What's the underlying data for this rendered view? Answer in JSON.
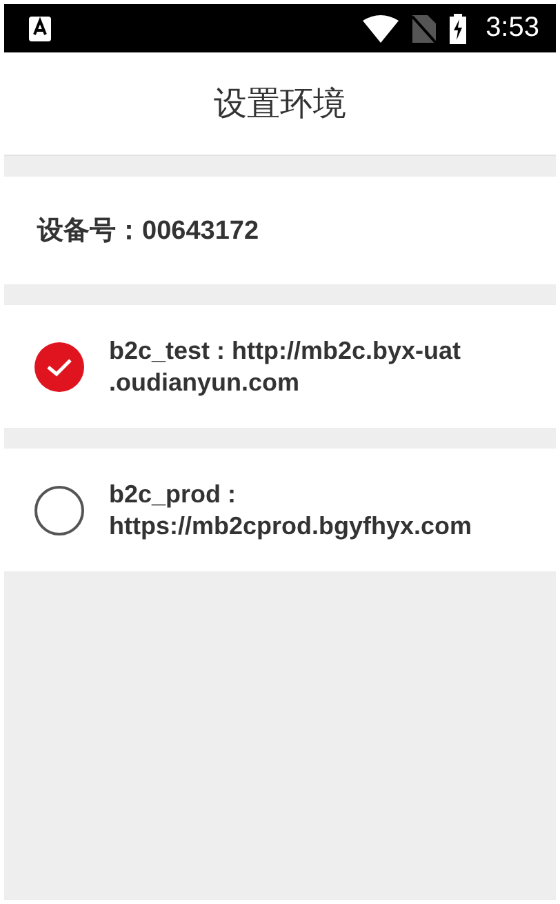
{
  "status_bar": {
    "time": "3:53"
  },
  "title": "设置环境",
  "device": {
    "label": "设备号：00643172"
  },
  "environments": [
    {
      "lines": [
        "b2c_test : http://mb2c.byx-uat",
        ".oudianyun.com"
      ],
      "selected": true
    },
    {
      "lines": [
        "b2c_prod :",
        "https://mb2cprod.bgyfhyx.com"
      ],
      "selected": false
    }
  ]
}
